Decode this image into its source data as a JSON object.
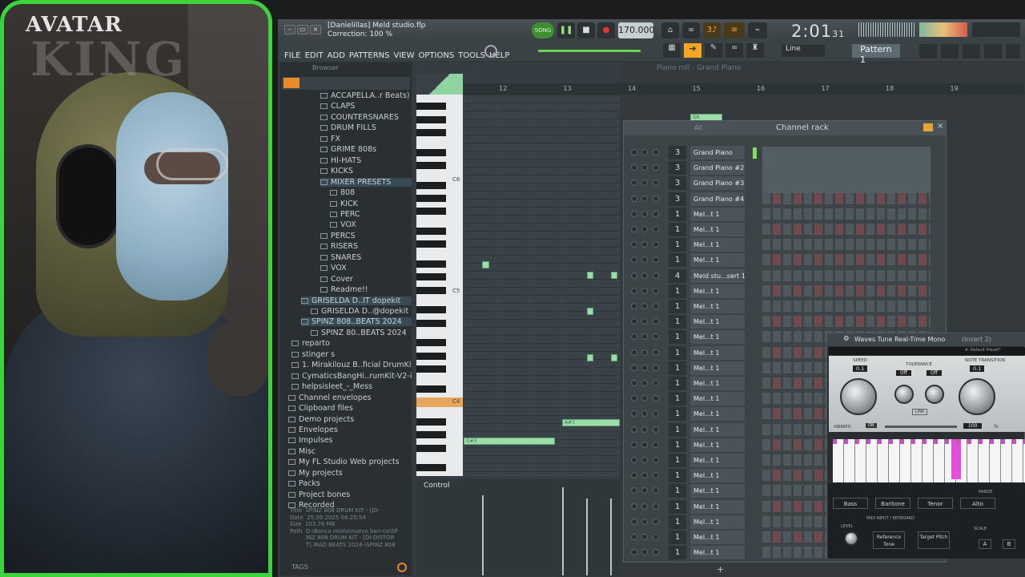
{
  "overlay": {
    "brand_line1": "AVATAR",
    "brand_line2": "KING"
  },
  "window": {
    "project_title": "[Danielillas] Meld studio.flp",
    "hint": "Correction: 100 %"
  },
  "menu": [
    "FILE",
    "EDIT",
    "ADD",
    "PATTERNS",
    "VIEW",
    "OPTIONS",
    "TOOLS",
    "HELP"
  ],
  "transport": {
    "mode": "SONG",
    "tempo": "170.000",
    "time": "2:01",
    "time_sub": "31",
    "snap": "Line",
    "pattern": "Pattern 1"
  },
  "browser": {
    "title": "Browser",
    "items": [
      "ACCAPELLA..r Beats)",
      "CLAPS",
      "COUNTERSNARES",
      "DRUM FILLS",
      "FX",
      "GRIME 808s",
      "HI-HATS",
      "KICKS",
      "MIXER PRESETS",
      "808",
      "KICK",
      "PERC",
      "VOX",
      "PERCS",
      "RISERS",
      "SNARES",
      "VOX",
      "Cover",
      "Readme!!",
      "GRISELDA D..IT dopekit",
      "GRISELDA D..@dopekit",
      "SPINZ 808..BEATS 2024",
      "SPINZ 80..BEATS 2024",
      "reparto",
      "stinger s",
      "1. Mirakilouz B..ficial DrumKit",
      "CymaticsBangHi..rumKit-V2-iBu",
      "helpsisleet_-_Mess",
      "Channel envelopes",
      "Clipboard files",
      "Demo projects",
      "Envelopes",
      "Impulses",
      "Misc",
      "My FL Studio Web projects",
      "My projects",
      "Packs",
      "Project bones",
      "Recorded"
    ],
    "info_title": "SPINZ 808 DRUM KIT - [DI-",
    "info_date": "25.09.2025 06:25:54",
    "info_size": "103.76 MB",
    "info_path": "D:\\Banco  mixto\\nuevo ban-co\\SPINZ 808 DRUM KIT - [DI-DISTORT] IRAD BEATS 2024-\\SPINZ 808 DRUM KIT - [DI-",
    "tags": "TAGS",
    "info_labels": [
      "Title",
      "Date",
      "Size",
      "Path"
    ]
  },
  "piano_roll": {
    "title": "Piano roll - Grand Piano",
    "bars": [
      "12",
      "13",
      "14",
      "15",
      "16",
      "17",
      "18",
      "19"
    ],
    "key_labels": [
      "C6",
      "C5",
      "C4"
    ],
    "notes": [
      "G6",
      "A#3",
      "G#3"
    ],
    "control": "Control"
  },
  "channel_rack": {
    "title": "Channel rack",
    "filter": "All",
    "channels": [
      {
        "n": "3",
        "name": "Grand Piano"
      },
      {
        "n": "3",
        "name": "Grand Piano #2"
      },
      {
        "n": "3",
        "name": "Grand Piano #3"
      },
      {
        "n": "3",
        "name": "Grand Piano #4"
      },
      {
        "n": "1",
        "name": "Mel...t 1"
      },
      {
        "n": "1",
        "name": "Mel...t 1"
      },
      {
        "n": "1",
        "name": "Mel...t 1"
      },
      {
        "n": "1",
        "name": "Mel...t 1"
      },
      {
        "n": "4",
        "name": "Meld stu...sert 1"
      },
      {
        "n": "1",
        "name": "Mel...t 1"
      },
      {
        "n": "1",
        "name": "Mel...t 1"
      },
      {
        "n": "1",
        "name": "Mel...t 1"
      },
      {
        "n": "1",
        "name": "Mel...t 1"
      },
      {
        "n": "1",
        "name": "Mel...t 1"
      },
      {
        "n": "1",
        "name": "Mel...t 1"
      },
      {
        "n": "1",
        "name": "Mel...t 1"
      },
      {
        "n": "1",
        "name": "Mel...t 1"
      },
      {
        "n": "1",
        "name": "Mel...t 1"
      },
      {
        "n": "1",
        "name": "Mel...t 1"
      },
      {
        "n": "1",
        "name": "Mel...t 1"
      },
      {
        "n": "1",
        "name": "Mel...t 1"
      },
      {
        "n": "1",
        "name": "Mel...t 1"
      },
      {
        "n": "1",
        "name": "Mel...t 1"
      },
      {
        "n": "1",
        "name": "Mel...t 1"
      },
      {
        "n": "1",
        "name": "Mel...t 1"
      },
      {
        "n": "1",
        "name": "Mel...t 1"
      },
      {
        "n": "1",
        "name": "Mel...t 1"
      }
    ]
  },
  "plugin": {
    "title": "Waves Tune Real-Time Mono",
    "insert": "(Insert 2)",
    "preset": "A: Default Preset*",
    "speed_label": "SPEED",
    "speed_val": "0.1",
    "tolerance_label": "TOLERANCE",
    "transition_label": "NOTE TRANSITION",
    "transition_val": "0.1",
    "off1": "Off",
    "off2": "Off",
    "link": "LINK",
    "vibrato": "VIBRATO",
    "on": "ON",
    "vib_val": "100",
    "pct": "%",
    "range": "RANGE",
    "ranges": [
      "Bass",
      "Baritone",
      "Tenor",
      "Alto"
    ],
    "midi": "MIDI INPUT / KEYBOARD",
    "level": "LEVEL",
    "ref": "Reference Tone",
    "target": "Target Pitch",
    "scale": "SCALE",
    "ab_a": "A",
    "ab_b": "B"
  }
}
